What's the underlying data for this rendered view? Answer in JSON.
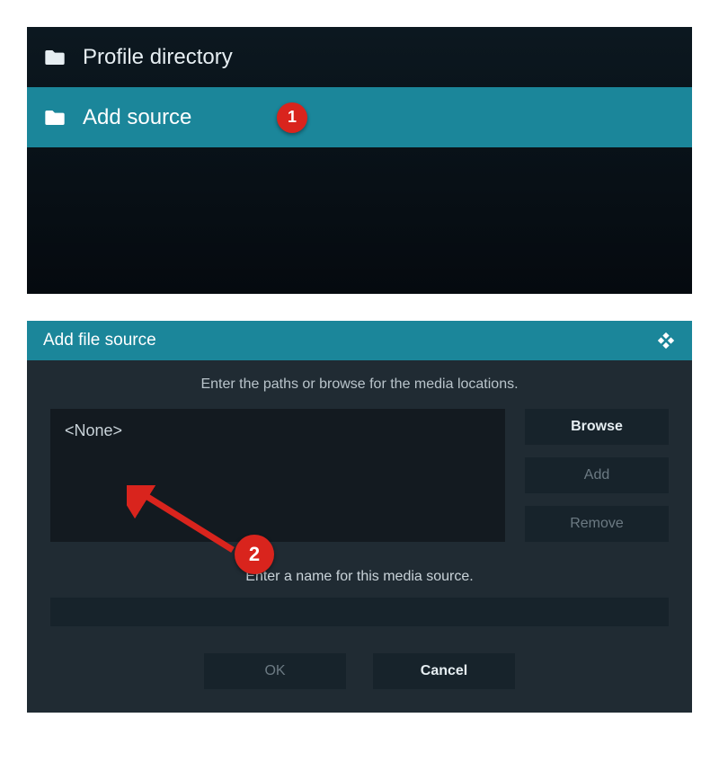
{
  "top": {
    "items": [
      {
        "label": "Profile directory",
        "selected": false
      },
      {
        "label": "Add source",
        "selected": true
      }
    ],
    "badge1": "1"
  },
  "dialog": {
    "title": "Add file source",
    "paths_instruction": "Enter the paths or browse for the media locations.",
    "path_value": "<None>",
    "browse_label": "Browse",
    "add_label": "Add",
    "remove_label": "Remove",
    "name_instruction": "Enter a name for this media source.",
    "ok_label": "OK",
    "cancel_label": "Cancel",
    "badge2": "2"
  }
}
